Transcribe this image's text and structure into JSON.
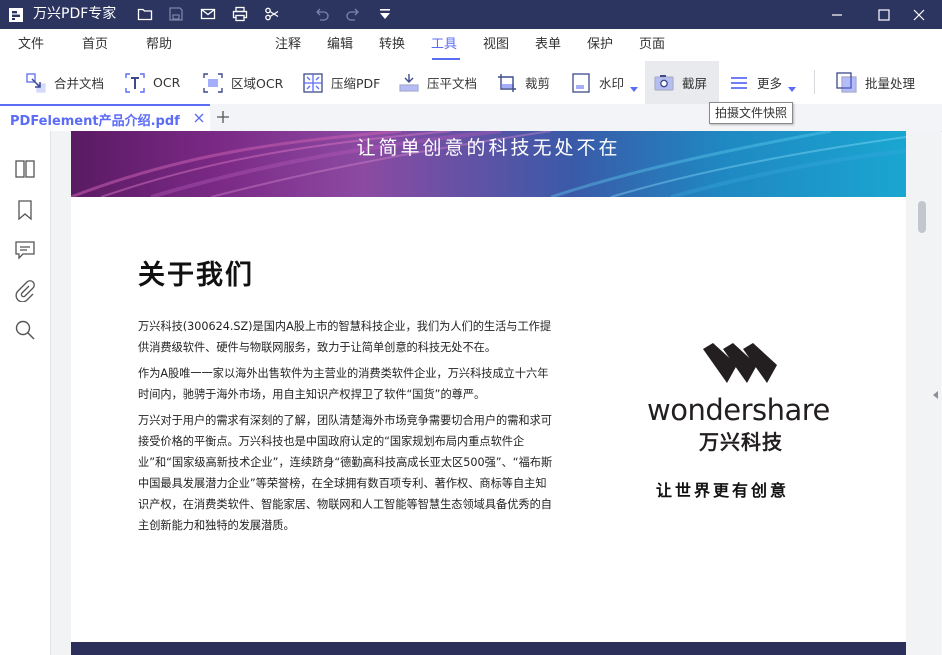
{
  "app": {
    "title": "万兴PDF专家"
  },
  "menu": {
    "items": [
      {
        "label": "文件"
      },
      {
        "label": "首页"
      },
      {
        "label": "帮助"
      },
      {
        "label": "注释"
      },
      {
        "label": "编辑"
      },
      {
        "label": "转换"
      },
      {
        "label": "工具"
      },
      {
        "label": "视图"
      },
      {
        "label": "表单"
      },
      {
        "label": "保护"
      },
      {
        "label": "页面"
      }
    ],
    "active": "工具"
  },
  "toolbar": {
    "tools": [
      {
        "label": "合并文档",
        "icon": "merge-icon"
      },
      {
        "label": "OCR",
        "icon": "ocr-icon"
      },
      {
        "label": "区域OCR",
        "icon": "area-ocr-icon"
      },
      {
        "label": "压缩PDF",
        "icon": "compress-icon"
      },
      {
        "label": "压平文档",
        "icon": "flatten-icon"
      },
      {
        "label": "裁剪",
        "icon": "crop-icon"
      },
      {
        "label": "水印",
        "icon": "watermark-icon"
      },
      {
        "label": "截屏",
        "icon": "screenshot-icon"
      },
      {
        "label": "更多",
        "icon": "more-icon"
      },
      {
        "label": "批量处理",
        "icon": "batch-icon"
      }
    ],
    "tooltip": "拍摄文件快照"
  },
  "tab": {
    "filename": "PDFelement产品介绍.pdf"
  },
  "document": {
    "banner_text": "让简单创意的科技无处不在",
    "heading": "关于我们",
    "paragraphs": [
      "万兴科技(300624.SZ)是国内A股上市的智慧科技企业，我们为人们的生活与工作提供消费级软件、硬件与物联网服务，致力于让简单创意的科技无处不在。",
      "作为A股唯一一家以海外出售软件为主营业的消费类软件企业，万兴科技成立十六年时间内，驰骋于海外市场，用自主知识产权捍卫了软件“国货”的尊严。",
      "万兴对于用户的需求有深刻的了解，团队清楚海外市场竞争需要切合用户的需和求可接受价格的平衡点。万兴科技也是中国政府认定的“国家规划布局内重点软件企业”和“国家级高新技术企业”，连续跻身“德勤高科技高成长亚太区500强”、“福布斯中国最具发展潜力企业”等荣誉榜，在全球拥有数百项专利、著作权、商标等自主知识产权，在消费类软件、智能家居、物联网和人工智能等智慧生态领域具备优秀的自主创新能力和独特的发展潜质。"
    ],
    "brand_en": "wondershare",
    "brand_cn": "万兴科技",
    "tagline": "让世界更有创意"
  },
  "colors": {
    "titlebar": "#2c3560",
    "accent": "#5b6cf5"
  }
}
